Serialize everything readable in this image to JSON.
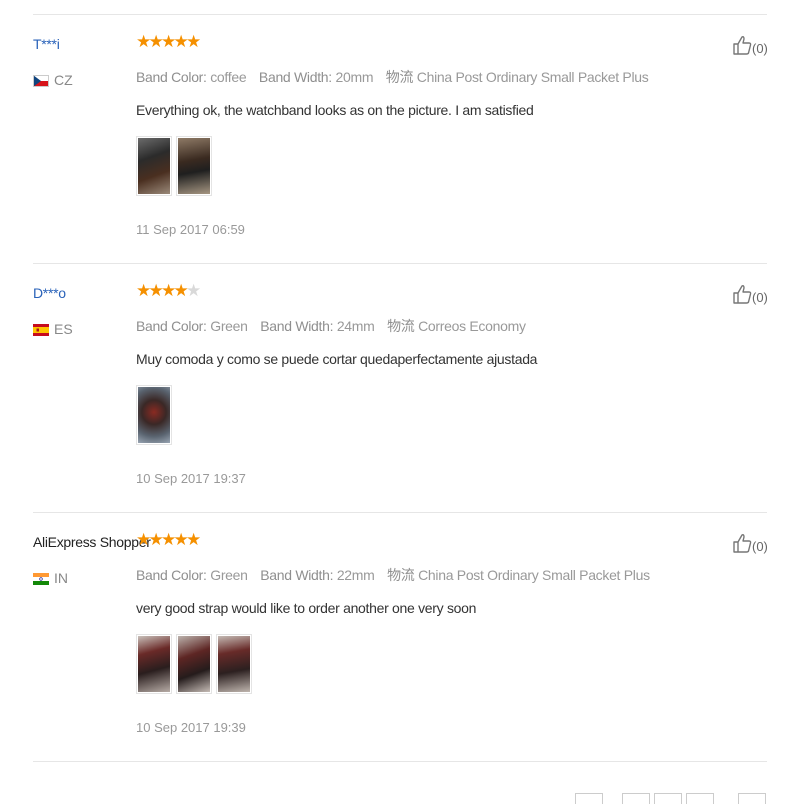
{
  "labels": {
    "band_color": "Band Color:",
    "band_width": "Band Width:",
    "shipping": "物流"
  },
  "reviews": [
    {
      "user": "T***i",
      "user_link": true,
      "country": "CZ",
      "flag": "cz",
      "rating": 5,
      "band_color": "coffee",
      "band_width": "20mm",
      "shipping": "China Post Ordinary Small Packet Plus",
      "text": "Everything ok, the watchband looks as on the picture. I am satisfied",
      "photos": 2,
      "date": "11 Sep 2017 06:59",
      "helpful": "(0)"
    },
    {
      "user": "D***o",
      "user_link": true,
      "country": "ES",
      "flag": "es",
      "rating": 4,
      "band_color": "Green",
      "band_width": "24mm",
      "shipping": "Correos Economy",
      "text": "Muy comoda y como se puede cortar quedaperfectamente ajustada",
      "photos": 1,
      "date": "10 Sep 2017 19:37",
      "helpful": "(0)"
    },
    {
      "user": "AliExpress Shopper",
      "user_link": false,
      "country": "IN",
      "flag": "in",
      "rating": 5,
      "band_color": "Green",
      "band_width": "22mm",
      "shipping": "China Post Ordinary Small Packet Plus",
      "text": "very good strap would like to order another one very soon",
      "photos": 3,
      "date": "10 Sep 2017 19:39",
      "helpful": "(0)"
    }
  ],
  "colors": {
    "star": "#f59000",
    "star_empty": "#d9d9d9",
    "username_link": "#2962b9",
    "divider": "#e6e6e6"
  },
  "icons": {
    "star": "star-icon",
    "helpful": "thumbs-up-icon",
    "flag": "country-flag-icon"
  }
}
